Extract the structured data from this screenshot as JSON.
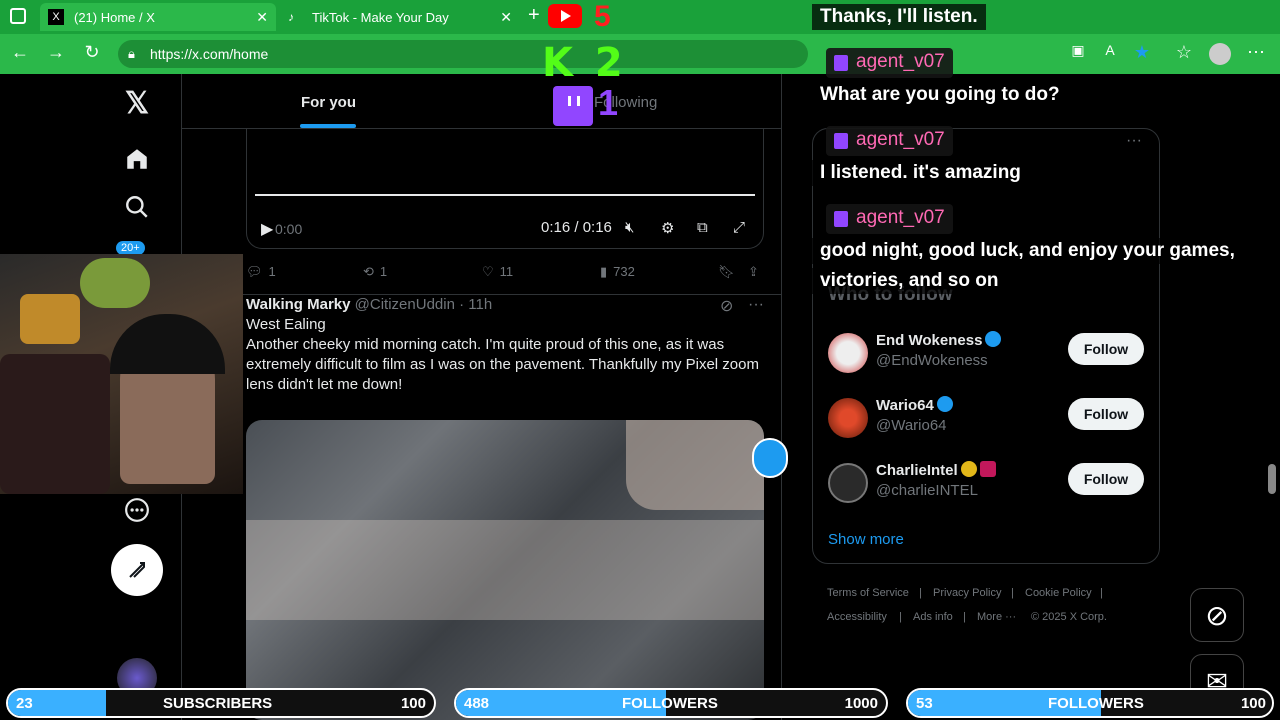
{
  "browser": {
    "tabs": [
      {
        "label": "(21) Home / X"
      },
      {
        "label": "TikTok - Make Your Day"
      }
    ],
    "url": "https://x.com/home"
  },
  "nav": {
    "notif_badge": "20+"
  },
  "timeline": {
    "tab_foryou": "For you",
    "tab_following": "Following",
    "video": {
      "time": "0:16 / 0:16",
      "start_time": "0:00"
    },
    "tweet1_actions": {
      "replies": "1",
      "reposts": "1",
      "likes": "11",
      "views": "732"
    },
    "tweet2": {
      "name": "Walking Marky",
      "handle": "@CitizenUddin",
      "time": "· 11h",
      "body": "West Ealing\nAnother cheeky mid morning catch. I'm quite proud of this one, as it was extremely difficult to film as I was on the pavement. Thankfully my Pixel zoom lens didn't let me down!"
    }
  },
  "right": {
    "who_to_follow_title": "Who to follow",
    "accounts": [
      {
        "name": "End Wokeness",
        "handle": "@EndWokeness",
        "follow": "Follow"
      },
      {
        "name": "Wario64",
        "handle": "@Wario64",
        "follow": "Follow"
      },
      {
        "name": "CharlieIntel",
        "handle": "@charlieINTEL",
        "follow": "Follow"
      }
    ],
    "show_more": "Show more",
    "footer": [
      "Terms of Service",
      "|",
      "Privacy Policy",
      "|",
      "Cookie Policy",
      "|",
      "Accessibility",
      "|",
      "Ads info",
      "|",
      "More ···",
      "© 2025 X Corp."
    ]
  },
  "chat": {
    "messages": [
      {
        "text": "Thanks, I'll listen."
      },
      {
        "user": "agent_v07",
        "text": "What are you going to do?"
      },
      {
        "user": "agent_v07",
        "text": "I listened. it's amazing"
      },
      {
        "user": "agent_v07",
        "text": "good night, good luck, and enjoy your games,",
        "text2": "victories, and so on"
      }
    ]
  },
  "overlay": {
    "youtube_count": "5",
    "kick_label": "K 2",
    "twitch_count": "1"
  },
  "stats": [
    {
      "left": "23",
      "label": "SUBSCRIBERS",
      "right": "100",
      "fraction": 0.23
    },
    {
      "left": "488",
      "label": "FOLLOWERS",
      "right": "1000",
      "fraction": 0.488
    },
    {
      "left": "53",
      "label": "FOLLOWERS",
      "right": "100",
      "fraction": 0.53
    }
  ],
  "colors": {
    "browser_green": "#2bb84a",
    "x_blue": "#1d9bf0",
    "chat_user": "#ff69b4",
    "stat_fill": "#3ab0ff"
  }
}
